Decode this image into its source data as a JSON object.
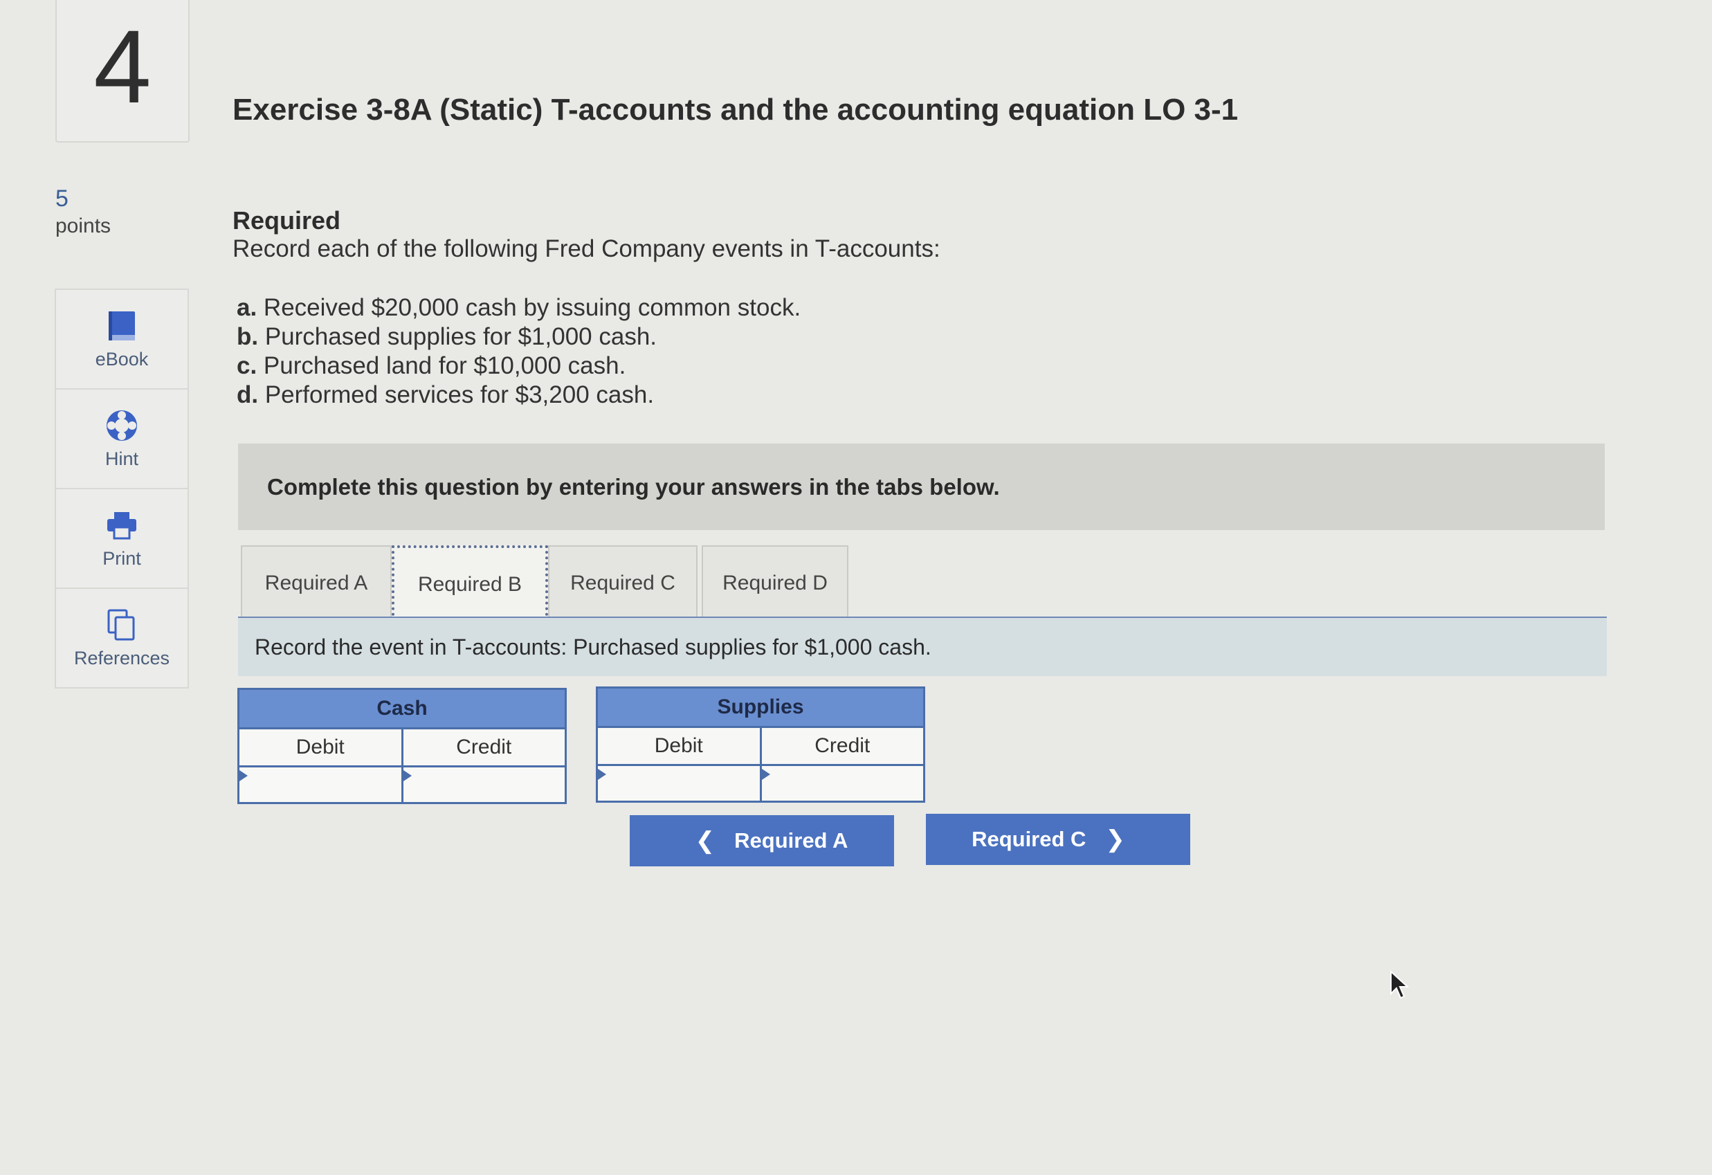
{
  "question": {
    "number": "4",
    "points_value": "5",
    "points_label": "points"
  },
  "tools": [
    {
      "label": "eBook",
      "icon": "book-icon"
    },
    {
      "label": "Hint",
      "icon": "lifebuoy-icon"
    },
    {
      "label": "Print",
      "icon": "printer-icon"
    },
    {
      "label": "References",
      "icon": "copy-icon"
    }
  ],
  "exercise": {
    "title": "Exercise 3-8A (Static) T-accounts and the accounting equation LO 3-1",
    "required_heading": "Required",
    "intro": "Record each of the following Fred Company events in T-accounts:",
    "events": [
      {
        "letter": "a.",
        "text": " Received $20,000 cash by issuing common stock."
      },
      {
        "letter": "b.",
        "text": " Purchased supplies for $1,000 cash."
      },
      {
        "letter": "c.",
        "text": " Purchased land for $10,000 cash."
      },
      {
        "letter": "d.",
        "text": " Performed services for $3,200 cash."
      }
    ]
  },
  "instruction": "Complete this question by entering your answers in the tabs below.",
  "tabs": [
    {
      "label": "Required A",
      "active": false
    },
    {
      "label": "Required B",
      "active": true
    },
    {
      "label": "Required C",
      "active": false
    },
    {
      "label": "Required D",
      "active": false
    }
  ],
  "event_prompt": "Record the event in T-accounts: Purchased supplies for $1,000 cash.",
  "t_accounts": [
    {
      "name": "Cash",
      "debit_label": "Debit",
      "credit_label": "Credit",
      "debit_value": "",
      "credit_value": ""
    },
    {
      "name": "Supplies",
      "debit_label": "Debit",
      "credit_label": "Credit",
      "debit_value": "",
      "credit_value": ""
    }
  ],
  "navigation": {
    "prev_label": "Required A",
    "next_label": "Required C",
    "prev_icon": "chevron-left-icon",
    "next_icon": "chevron-right-icon"
  },
  "colors": {
    "accent_blue": "#4b72c0",
    "taccount_header": "#6a8fd0",
    "instruction_bg": "#d3d3cf",
    "event_bar_bg": "#d5dfe2"
  }
}
